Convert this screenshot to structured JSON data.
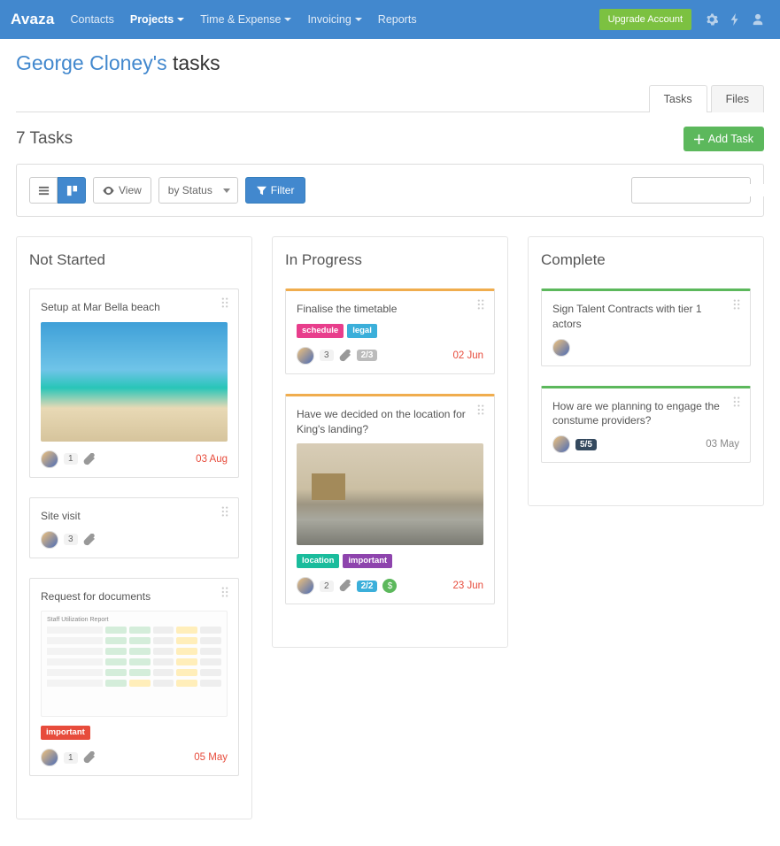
{
  "nav": {
    "brand": "Avaza",
    "items": [
      "Contacts",
      "Projects",
      "Time & Expense",
      "Invoicing",
      "Reports"
    ],
    "upgrade": "Upgrade Account"
  },
  "header": {
    "who": "George Cloney's",
    "suffix": "tasks"
  },
  "tabs": {
    "tasks": "Tasks",
    "files": "Files"
  },
  "count_label": "7 Tasks",
  "add_label": "Add Task",
  "toolbar": {
    "view": "View",
    "group": "by Status",
    "filter": "Filter"
  },
  "columns": {
    "not_started": {
      "title": "Not Started",
      "cards": [
        {
          "title": "Setup at Mar Bella beach",
          "comments": "1",
          "due": "03 Aug"
        },
        {
          "title": "Site visit",
          "comments": "3"
        },
        {
          "title": "Request for documents",
          "tag": "important",
          "comments": "1",
          "due": "05 May",
          "report_title": "Staff Utilization Report"
        }
      ]
    },
    "in_progress": {
      "title": "In Progress",
      "cards": [
        {
          "title": "Finalise the timetable",
          "tags": {
            "schedule": "schedule",
            "legal": "legal"
          },
          "comments": "3",
          "checklist": "2/3",
          "due": "02 Jun"
        },
        {
          "title": "Have we decided on the location for King's landing?",
          "tags": {
            "location": "location",
            "important": "important"
          },
          "comments": "2",
          "checklist": "2/2",
          "dollar": "$",
          "due": "23 Jun"
        }
      ]
    },
    "complete": {
      "title": "Complete",
      "cards": [
        {
          "title": "Sign Talent Contracts with tier 1 actors"
        },
        {
          "title": "How are we planning to engage the constume providers?",
          "checklist": "5/5",
          "due": "03 May"
        }
      ]
    }
  }
}
